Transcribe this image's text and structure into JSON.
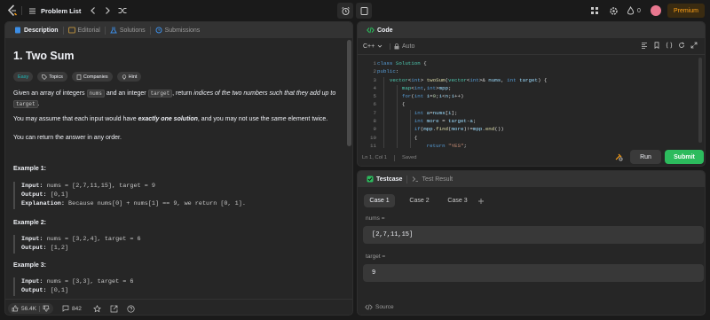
{
  "topbar": {
    "problem_list": "Problem List",
    "points": "0",
    "premium": "Premium"
  },
  "left_panel": {
    "tabs": [
      "Description",
      "Editorial",
      "Solutions",
      "Submissions"
    ],
    "title": "1. Two Sum",
    "tags": [
      "Easy",
      "Topics",
      "Companies",
      "Hint"
    ],
    "para1_a": "Given an array of integers ",
    "para1_code1": "nums",
    "para1_b": " and an integer ",
    "para1_code2": "target",
    "para1_c": ", return ",
    "para1_italic": "indices of the two numbers such that they add up to",
    "para1_code3": "target",
    "para1_end": ".",
    "para2_a": "You may assume that each input would have ",
    "para2_bold": "exactly one solution",
    "para2_b": ", and you may not use the ",
    "para2_italic": "same",
    "para2_c": " element twice.",
    "para3": "You can return the answer in any order.",
    "examples": [
      {
        "heading": "Example 1:",
        "input": "nums = [2,7,11,15], target = 9",
        "output": "[0,1]",
        "explanation": "Because nums[0] + nums[1] == 9, we return [0, 1]."
      },
      {
        "heading": "Example 2:",
        "input": "nums = [3,2,4], target = 6",
        "output": "[1,2]"
      },
      {
        "heading": "Example 3:",
        "input": "nums = [3,3], target = 6",
        "output": "[0,1]"
      }
    ],
    "labels": {
      "input": "Input:",
      "output": "Output:",
      "explanation": "Explanation:"
    },
    "footer": {
      "likes": "56.4K",
      "comments": "842"
    }
  },
  "code_panel": {
    "tab": "Code",
    "language": "C++",
    "auto": "Auto",
    "line_numbers": [
      "1",
      "2",
      "3",
      "4",
      "5",
      "6",
      "7",
      "8",
      "9",
      "10",
      "11"
    ],
    "status": "Ln 1, Col 1",
    "saved": "Saved",
    "run": "Run",
    "submit": "Submit"
  },
  "test_panel": {
    "tabs": [
      "Testcase",
      "Test Result"
    ],
    "cases": [
      "Case 1",
      "Case 2",
      "Case 3"
    ],
    "fields": [
      {
        "label": "nums =",
        "value": "[2,7,11,15]"
      },
      {
        "label": "target =",
        "value": "9"
      }
    ],
    "source": "Source"
  },
  "colors": {
    "accent": "#ffa116",
    "easy": "#1cbaba",
    "submit": "#2cbb5d",
    "bg": "#1a1a1a",
    "panel": "#262626"
  }
}
